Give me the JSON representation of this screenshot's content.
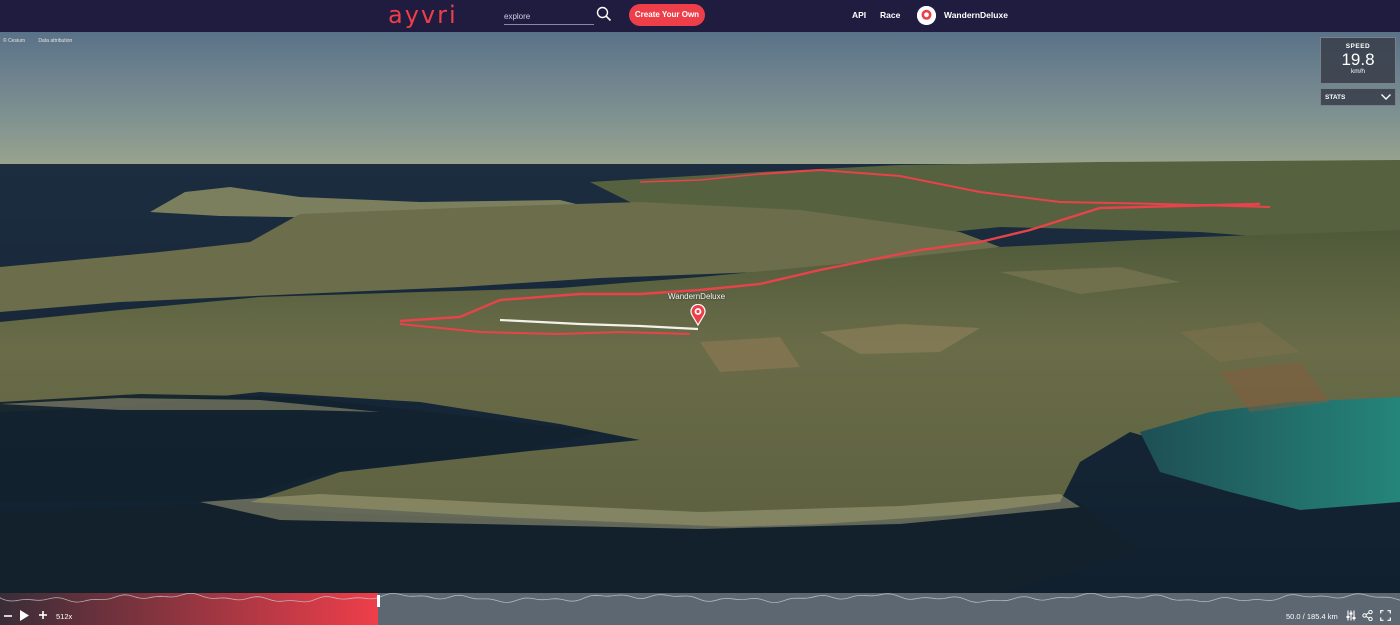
{
  "header": {
    "logo_text": "ayvri",
    "search_placeholder": "explore",
    "create_button_label": "Create Your Own",
    "nav_api": "API",
    "nav_race": "Race",
    "username": "WandernDeluxe"
  },
  "map": {
    "attribution_1": "© Cesium",
    "attribution_2": "Data attribution",
    "marker_label": "WandernDeluxe",
    "speed_label": "SPEED",
    "speed_value": "19.8",
    "speed_unit": "km/h",
    "stats_label": "STATS"
  },
  "playback": {
    "multiplier": "512x",
    "distance_text": "50.0 / 185.4 km",
    "progress_fraction": 0.27
  },
  "colors": {
    "brand": "#ee3e4a",
    "navbar": "#1f1c40",
    "track": "#e8434a"
  },
  "icons": [
    "search-icon",
    "avatar-icon",
    "chevron-down-icon",
    "minus-icon",
    "play-icon",
    "plus-icon",
    "settings-icon",
    "share-icon",
    "fullscreen-icon",
    "location-marker-icon"
  ]
}
